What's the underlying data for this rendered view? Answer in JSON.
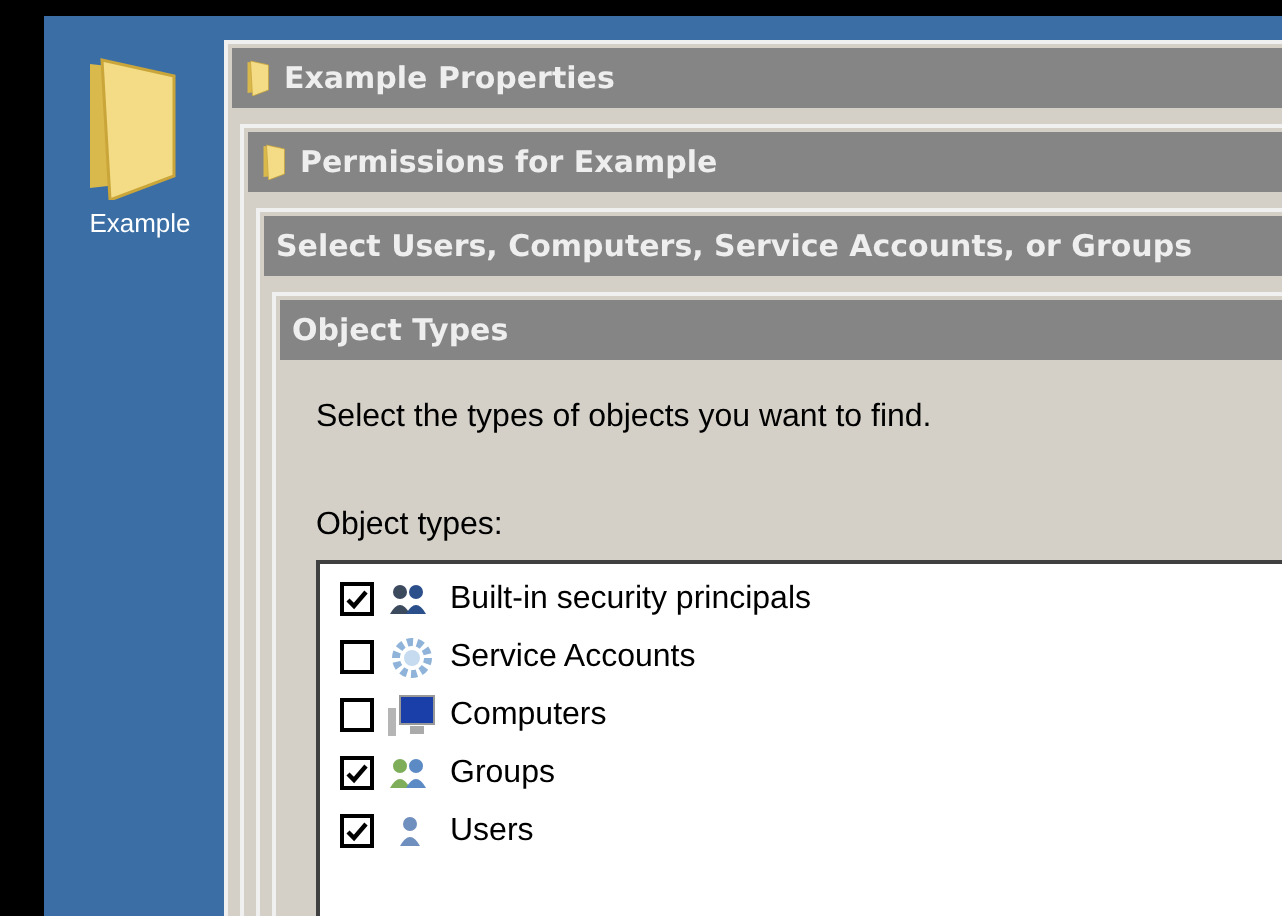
{
  "desktop": {
    "icon_label": "Example"
  },
  "dialogs": [
    {
      "title": "Example Properties",
      "kind": "folder"
    },
    {
      "title": "Permissions for Example",
      "kind": "folder"
    },
    {
      "title": "Select Users, Computers, Service Accounts, or Groups",
      "kind": "plain"
    },
    {
      "title": "Object Types",
      "kind": "plain"
    }
  ],
  "instruction": "Select the types of objects you want to find.",
  "list_label": "Object types:",
  "object_types": [
    {
      "label": "Built-in security principals",
      "kind": "principals",
      "checked": true
    },
    {
      "label": "Service Accounts",
      "kind": "service",
      "checked": false
    },
    {
      "label": "Computers",
      "kind": "computer",
      "checked": false
    },
    {
      "label": "Groups",
      "kind": "group",
      "checked": true
    },
    {
      "label": "Users",
      "kind": "user",
      "checked": true
    }
  ]
}
